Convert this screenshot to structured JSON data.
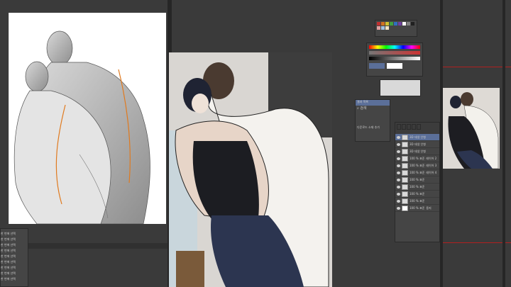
{
  "colors": {
    "background": "#3a3a3a",
    "panel": "#454545",
    "accent_blue": "#5b6f99",
    "guide_red": "#b02020",
    "guide_orange": "#e07a1f"
  },
  "left_tool_panel": {
    "rows": [
      "한 번에 선택",
      "한 번에 선택",
      "한 번에 선택",
      "한 번에 선택",
      "한 번에 선택",
      "한 번에 선택",
      "한 번에 선택",
      "한 번에 선택",
      "한 번에 선택"
    ]
  },
  "sub_tool_panel": {
    "header": "결과 목록",
    "search_placeholder": "검색",
    "filter_label": "다운로드 소재 추가"
  },
  "layer_panel": {
    "rows": [
      {
        "name": "3D 데생 인형",
        "sub": "",
        "selected": true
      },
      {
        "name": "3D 데생 인형",
        "sub": "",
        "selected": false
      },
      {
        "name": "3D 데생 인형",
        "sub": "",
        "selected": false
      },
      {
        "name": "100 % 표준",
        "sub": "레이어 2",
        "selected": false
      },
      {
        "name": "100 % 표준",
        "sub": "레이어 3",
        "selected": false
      },
      {
        "name": "100 % 표준",
        "sub": "레이어 4",
        "selected": false
      },
      {
        "name": "100 % 표준",
        "sub": "",
        "selected": false
      },
      {
        "name": "100 % 표준",
        "sub": "",
        "selected": false
      },
      {
        "name": "100 % 표준",
        "sub": "",
        "selected": false
      },
      {
        "name": "100 % 표준",
        "sub": "",
        "selected": false
      },
      {
        "name": "100 % 표준",
        "sub": "용지",
        "selected": false
      }
    ]
  },
  "swatch_colors": [
    "#c03030",
    "#d07020",
    "#d0c030",
    "#40a040",
    "#3070c0",
    "#7040a0",
    "#ffffff",
    "#808080",
    "#202020",
    "#e0a0a0",
    "#a0c0e0",
    "#f0e0c0"
  ],
  "icons": [
    "color-wheel-icon",
    "visibility-icon",
    "layer-thumbnail-icon",
    "folder-icon"
  ]
}
